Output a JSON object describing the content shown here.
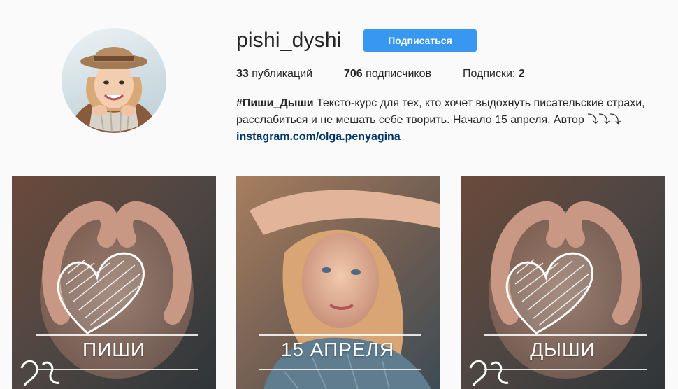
{
  "profile": {
    "username": "pishi_dyshi",
    "follow_label": "Подписаться"
  },
  "stats": {
    "posts_count": "33",
    "posts_label": " публикаций",
    "followers_count": "706",
    "followers_label": " подписчиков",
    "following_label": "Подписки: ",
    "following_count": "2"
  },
  "bio": {
    "hashtag": "#Пиши_Дыши",
    "text": " Тексто-курс для тех, кто хочет выдохнуть писательские страхи, расслабиться и не мешать себе творить. Начало 15 апреля. Автор ⤵⤵⤵",
    "link": "instagram.com/olga.penyagina"
  },
  "posts": [
    {
      "caption": "ПИШИ"
    },
    {
      "caption": "15 АПРЕЛЯ"
    },
    {
      "caption": "ДЫШИ"
    }
  ],
  "colors": {
    "accent": "#3897f0",
    "link": "#003569",
    "background": "#fafafa"
  }
}
